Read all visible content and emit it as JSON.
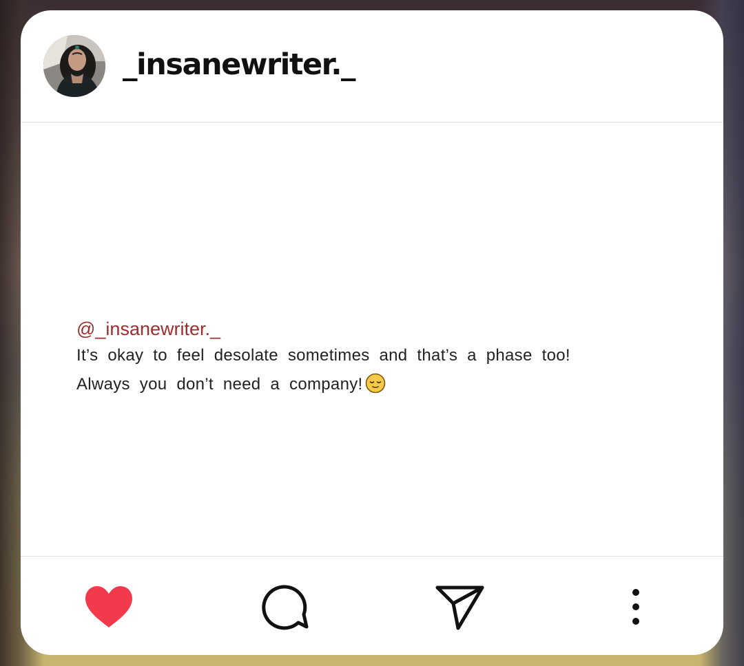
{
  "profile": {
    "username": "_insanewriter._"
  },
  "post": {
    "handle": "@_insanewriter._",
    "line1": "It’s okay to feel desolate sometimes and that’s a phase too!",
    "line2": "Always you don’t need a company!",
    "emoji": "relieved-face"
  },
  "actions": {
    "like_icon": "heart-icon",
    "comment_icon": "comment-icon",
    "share_icon": "send-icon",
    "more_icon": "more-vertical-icon",
    "like_color": "#f23a4c",
    "icon_color": "#111111"
  }
}
